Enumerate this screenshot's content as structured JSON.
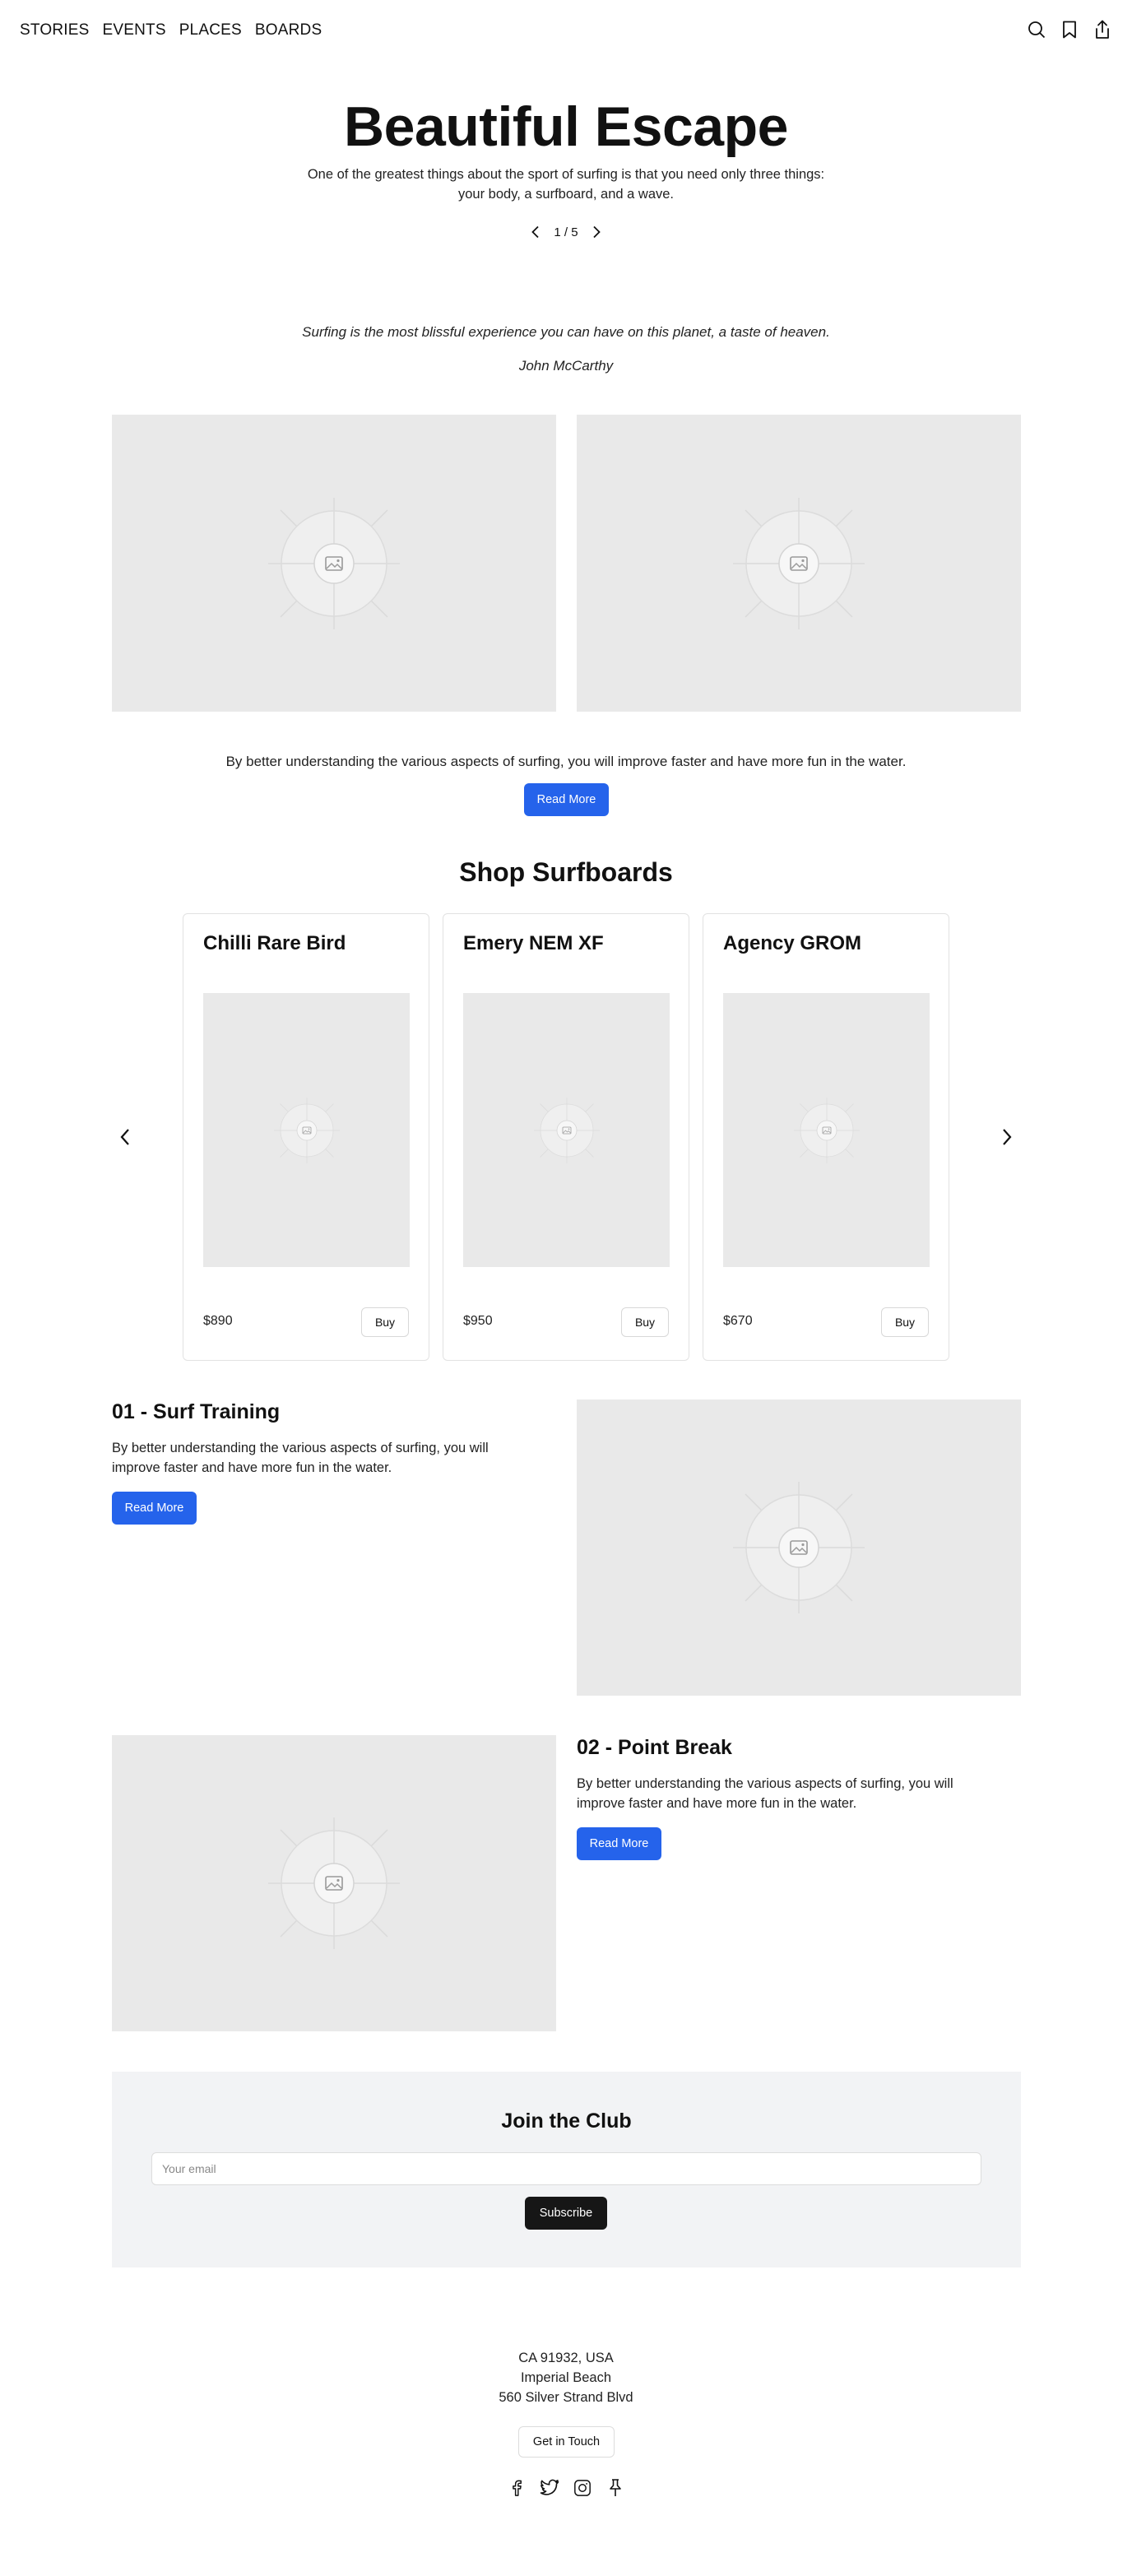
{
  "nav": {
    "links": [
      "STORIES",
      "EVENTS",
      "PLACES",
      "BOARDS"
    ],
    "icons": [
      "search-icon",
      "bookmark-icon",
      "share-icon"
    ]
  },
  "hero": {
    "title": "Beautiful Escape",
    "subtitle_line1": "One of the greatest things about the sport of surfing is that you need only three things:",
    "subtitle_line2": "your body, a surfboard, and a wave.",
    "pager": "1 / 5"
  },
  "quote": {
    "text": "Surfing is the most blissful experience you can have on this planet, a taste of heaven.",
    "author": "John McCarthy"
  },
  "blurb": {
    "text": "By better understanding the various aspects of surfing, you will improve faster and have more fun in the water.",
    "button": "Read More"
  },
  "shop": {
    "title": "Shop Surfboards",
    "products": [
      {
        "name": "Chilli Rare Bird",
        "price": "$890",
        "button": "Buy"
      },
      {
        "name": "Emery NEM XF",
        "price": "$950",
        "button": "Buy"
      },
      {
        "name": "Agency GROM",
        "price": "$670",
        "button": "Buy"
      }
    ]
  },
  "features": [
    {
      "title": "01 - Surf Training",
      "text_line1": "By better understanding the various aspects of surfing, you will",
      "text_line2": "improve faster and have more fun in the water.",
      "button": "Read More"
    },
    {
      "title": "02 - Point Break",
      "text_line1": "By better understanding the various aspects of surfing, you will",
      "text_line2": "improve faster and have more fun in the water.",
      "button": "Read More"
    }
  ],
  "club": {
    "title": "Join the Club",
    "email_placeholder": "Your email",
    "button": "Subscribe"
  },
  "footer": {
    "address": [
      "CA 91932, USA",
      "Imperial Beach",
      "560 Silver Strand Blvd"
    ],
    "button": "Get in Touch",
    "social_icons": [
      "facebook-icon",
      "twitter-icon",
      "instagram-icon",
      "pin-icon"
    ]
  }
}
